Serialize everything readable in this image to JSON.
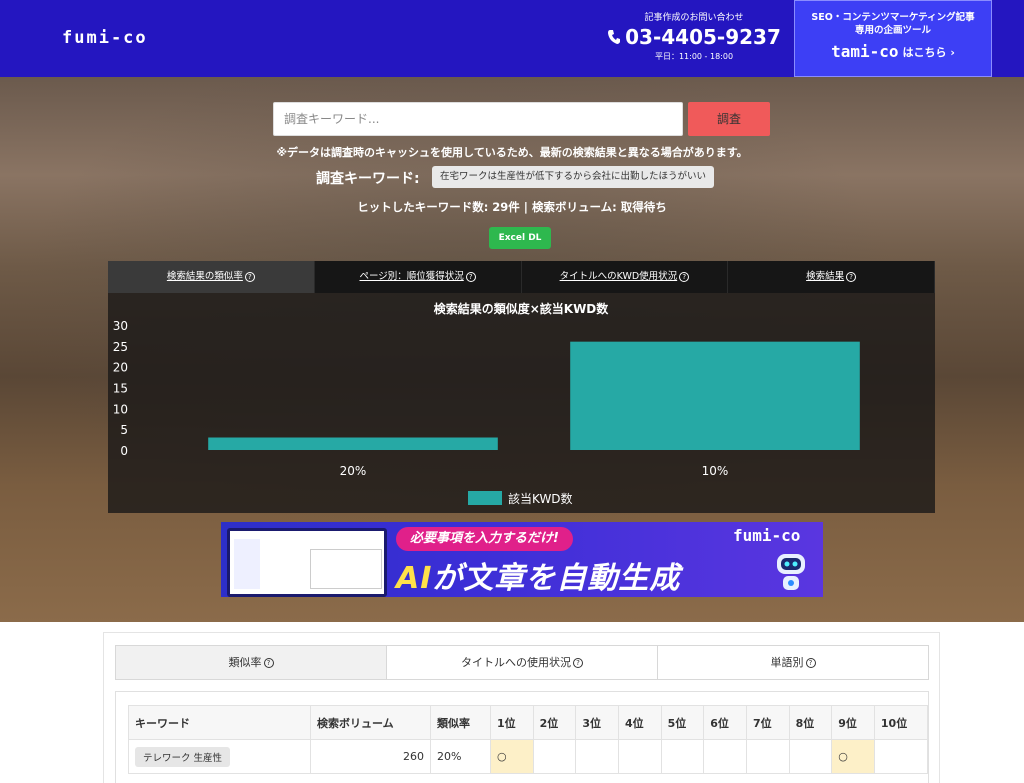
{
  "header": {
    "logo": "fumi-co",
    "contact_caption": "記事作成のお問い合わせ",
    "phone": "03-4405-9237",
    "hours": "平日：11:00 - 18:00",
    "promo_line1": "SEO・コンテンツマーケティング記事",
    "promo_line2": "専用の企画ツール",
    "promo_brand": "tami-co",
    "promo_link": "はこちら ›"
  },
  "search": {
    "placeholder": "調査キーワード...",
    "button_label": "調査",
    "notice": "※データは調査時のキャッシュを使用しているため、最新の検索結果と異なる場合があります。",
    "keyword_label": "調査キーワード:",
    "keyword_value": "在宅ワークは生産性が低下するから会社に出勤したほうがいい",
    "stats": "ヒットしたキーワード数: 29件 | 検索ボリューム: 取得待ち",
    "excel_label": "Excel DL"
  },
  "chart_tabs": [
    "検索結果の類似率",
    "ページ別：順位獲得状況",
    "タイトルへのKWD使用状況",
    "検索結果"
  ],
  "chart_data": {
    "type": "bar",
    "title": "検索結果の類似度×該当KWD数",
    "categories": [
      "20%",
      "10%"
    ],
    "series": [
      {
        "name": "該当KWD数",
        "values": [
          3,
          26
        ]
      }
    ],
    "ylim": [
      0,
      30
    ],
    "yticks": [
      "30",
      "25",
      "20",
      "15",
      "10",
      "5",
      "0"
    ],
    "color": "#26a9a5",
    "legend_position": "bottom"
  },
  "banner": {
    "tagline": "必要事項を入力するだけ!",
    "head_ai": "AI",
    "head_rest": "が文章を自動生成",
    "brand": "fumi-co"
  },
  "lower_tabs": [
    "類似率",
    "タイトルへの使用状況",
    "単語別"
  ],
  "table": {
    "headers": [
      "キーワード",
      "検索ボリューム",
      "類似率",
      "1位",
      "2位",
      "3位",
      "4位",
      "5位",
      "6位",
      "7位",
      "8位",
      "9位",
      "10位"
    ],
    "rows": [
      {
        "keyword": "テレワーク 生産性",
        "volume": "260",
        "rate": "20%",
        "marks": [
          "○",
          "",
          "",
          "",
          "",
          "",
          "",
          "",
          "○",
          ""
        ]
      }
    ]
  },
  "colors": {
    "header": "#2416c0",
    "search_button": "#f05a5a",
    "excel": "#2eb84e",
    "bar": "#26a9a5",
    "hit_cell": "#fdf0c8"
  }
}
